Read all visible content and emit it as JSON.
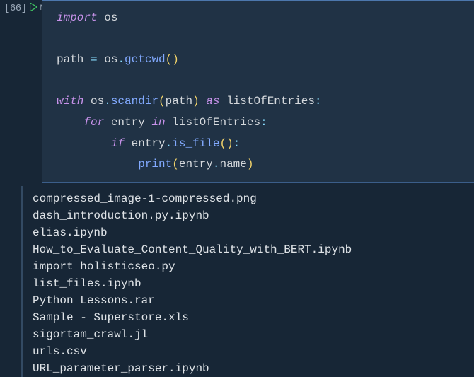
{
  "cell": {
    "exec_count": "[66]",
    "markdown_icon_label": "M↓",
    "code": {
      "l1": {
        "kw_import": "import",
        "mod": "os"
      },
      "l2": {
        "name_path": "path",
        "eq": "=",
        "mod": "os",
        "dot": ".",
        "func": "getcwd"
      },
      "l3": {
        "kw_with": "with",
        "mod": "os",
        "dot": ".",
        "func": "scandir",
        "arg": "path",
        "kw_as": "as",
        "alias": "listOfEntries",
        "colon": ":"
      },
      "l4": {
        "kw_for": "for",
        "var": "entry",
        "kw_in": "in",
        "iter": "listOfEntries",
        "colon": ":"
      },
      "l5": {
        "kw_if": "if",
        "var": "entry",
        "dot": ".",
        "func": "is_file",
        "colon": ":"
      },
      "l6": {
        "func": "print",
        "var": "entry",
        "dot": ".",
        "attr": "name"
      }
    }
  },
  "output_lines": [
    "compressed_image-1-compressed.png",
    "dash_introduction.py.ipynb",
    "elias.ipynb",
    "How_to_Evaluate_Content_Quality_with_BERT.ipynb",
    "import holisticseo.py",
    "list_files.ipynb",
    "Python Lessons.rar",
    "Sample - Superstore.xls",
    "sigortam_crawl.jl",
    "urls.csv",
    "URL_parameter_parser.ipynb"
  ]
}
